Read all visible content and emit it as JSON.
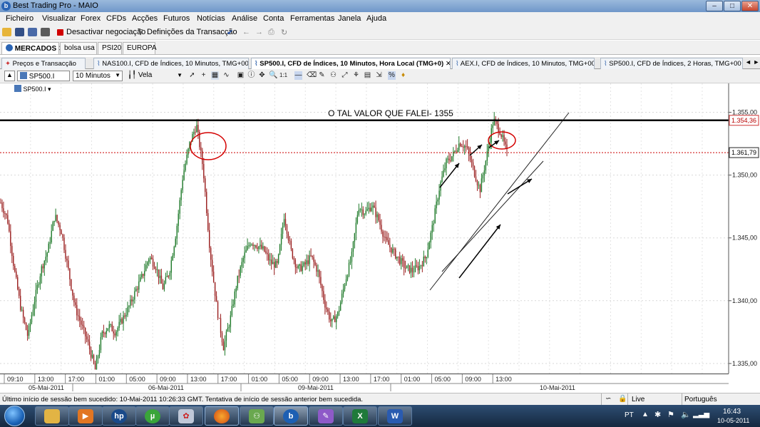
{
  "window": {
    "title": "Best Trading Pro - MAIO",
    "app_icon": "b",
    "minimize": "–",
    "maximize": "□",
    "close": "✕"
  },
  "menu": [
    "Ficheiro",
    "Visualizar",
    "Forex",
    "CFDs",
    "Acções",
    "Futuros",
    "Notícias",
    "Análise",
    "Conta",
    "Ferramentas",
    "Janela",
    "Ajuda"
  ],
  "toolbar": {
    "deactivate_label": "Desactivar negociação",
    "settings_label": "Definições da Transacção",
    "icons": [
      "open-folder-icon",
      "save-icon",
      "save-all-icon",
      "print-icon",
      "stop-trading-icon",
      "filter-icon",
      "checkmark-icon",
      "back-arrow-icon",
      "forward-arrow-icon",
      "printer-icon",
      "refresh-icon"
    ]
  },
  "market_tabs": [
    {
      "label": "MERCADOS",
      "close": "✕"
    },
    {
      "label": "bolsa usa"
    },
    {
      "label": "PSI20"
    },
    {
      "label": "EUROPA"
    }
  ],
  "chart_tabs": [
    {
      "label": "Preços e Transacção"
    },
    {
      "label": "NAS100.I, CFD de Índices, 10 Minutos, TMG+00"
    },
    {
      "label": "SP500.I, CFD de Índices, 10 Minutos, Hora Local (TMG+0)",
      "close": "✕"
    },
    {
      "label": "AEX.I, CFD de Índices, 10 Minutos, TMG+00"
    },
    {
      "label": "SP500.I, CFD de Índices, 2 Horas, TMG+00"
    }
  ],
  "tab_scroll": "◄ ►",
  "chart_toolbar": {
    "symbol": "SP500.I",
    "interval": "10 Minutos",
    "style": "Vela",
    "symbol_legend": "SP500.I"
  },
  "chart_data": {
    "type": "candlestick",
    "series_name": "SP500.I",
    "annotation": "O TAL VALOR QUE FALEI- 1355",
    "ylim": [
      1334.2,
      1357.3
    ],
    "y_ticks": [
      "1.355,00",
      "1.350,00",
      "1.345,00",
      "1.340,00",
      "1.335,00"
    ],
    "y_tick_values": [
      1355,
      1350,
      1345,
      1340,
      1335
    ],
    "resistance_level": 1354.36,
    "resistance_label": "1.354,36",
    "last_price_level": 1351.79,
    "last_price_label": "1.361,79",
    "price_path": [
      1347.8,
      1346.5,
      1342.5,
      1339.3,
      1337.2,
      1340.0,
      1342.5,
      1344.0,
      1346.8,
      1345.5,
      1342.5,
      1339.5,
      1338.0,
      1336.5,
      1334.5,
      1337.3,
      1338.0,
      1337.5,
      1338.5,
      1339.5,
      1340.8,
      1342.0,
      1343.5,
      1342.7,
      1341.0,
      1342.3,
      1345.5,
      1350.0,
      1352.5,
      1354.0,
      1350.5,
      1344.0,
      1339.5,
      1336.3,
      1338.5,
      1341.5,
      1343.5,
      1344.7,
      1344.4,
      1344.0,
      1343.0,
      1342.8,
      1346.8,
      1344.0,
      1342.5,
      1342.8,
      1343.5,
      1342.3,
      1339.8,
      1338.2,
      1339.0,
      1341.5,
      1343.5,
      1347.5,
      1347.0,
      1347.6,
      1346.4,
      1344.8,
      1344.0,
      1343.3,
      1342.6,
      1342.4,
      1342.7,
      1343.5,
      1346.0,
      1349.0,
      1351.0,
      1351.6,
      1352.6,
      1352.2,
      1350.5,
      1348.8,
      1351.5,
      1354.4,
      1353.5,
      1351.8
    ],
    "x_ticks": [
      "09:10",
      "13:00",
      "17:00",
      "01:00",
      "05:00",
      "09:00",
      "13:00",
      "17:00",
      "01:00",
      "05:00",
      "09:00",
      "13:00",
      "17:00",
      "01:00",
      "05:00",
      "09:00",
      "13:00"
    ],
    "date_labels": [
      "05-Mai-2011",
      "06-Mai-2011",
      "09-Mai-2011",
      "10-Mai-2011"
    ],
    "colors": {
      "up": "#1f7a2a",
      "down": "#9a1f1f",
      "resistance": "#000000",
      "last_price": "#cc0000",
      "circle": "#d40000",
      "annotation": "#000000"
    }
  },
  "status": {
    "message": "Último início de sessão bem sucedido: 10-Mai-2011 10:26:33 GMT. Tentativa de início de sessão anterior bem sucedida.",
    "mode": "Live",
    "language": "Português"
  },
  "taskbar": {
    "apps": [
      "windows-start-icon",
      "file-explorer-icon",
      "media-player-icon",
      "hp-icon",
      "utorrent-icon",
      "paint-icon",
      "firefox-icon",
      "network-icon",
      "best-trading-icon",
      "paint-app-icon",
      "excel-icon",
      "word-icon"
    ],
    "tray_lang": "PT",
    "time": "16:43",
    "date": "10-05-2011"
  }
}
